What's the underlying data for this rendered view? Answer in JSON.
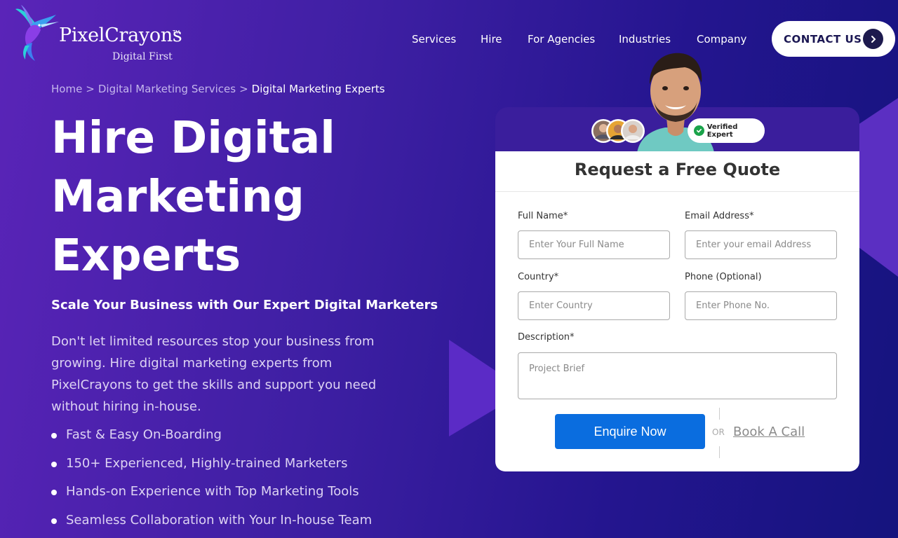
{
  "brand": {
    "name": "PixelCrayons",
    "tm": "TM",
    "tagline": "Digital First"
  },
  "nav": {
    "items": [
      "Services",
      "Hire",
      "For Agencies",
      "Industries",
      "Company"
    ],
    "contact_label": "CONTACT US"
  },
  "breadcrumb": {
    "home": "Home",
    "parent": "Digital Marketing Services",
    "current": "Digital Marketing Experts",
    "separator": ">"
  },
  "hero": {
    "title_lines": [
      "Hire Digital",
      "Marketing",
      "Experts"
    ],
    "subtitle": "Scale Your Business with Our Expert Digital Marketers",
    "description": "Don't let limited resources stop your business from growing. Hire digital marketing experts from PixelCrayons to get the skills and support you need without hiring in-house.",
    "bullets": [
      "Fast & Easy On-Boarding",
      "150+ Experienced, Highly-trained Marketers",
      "Hands-on Experience with Top Marketing Tools",
      "Seamless Collaboration with Your In-house Team"
    ]
  },
  "form": {
    "badge": "Verified Expert",
    "title": "Request a Free Quote",
    "full_name": {
      "label": "Full Name*",
      "placeholder": "Enter Your Full Name",
      "value": ""
    },
    "email": {
      "label": "Email Address*",
      "placeholder": "Enter your email Address",
      "value": ""
    },
    "country": {
      "label": "Country*",
      "placeholder": "Enter Country",
      "value": ""
    },
    "phone": {
      "label": "Phone (Optional)",
      "placeholder": "Enter Phone No.",
      "value": ""
    },
    "description": {
      "label": "Description*",
      "placeholder": "Project Brief",
      "value": ""
    },
    "submit_label": "Enquire Now",
    "or_text": "OR",
    "book_label": "Book A Call"
  },
  "colors": {
    "accent_blue": "#0a6ddf",
    "bg_purple": "#4a22ad",
    "bg_navy": "#16147e",
    "verified_green": "#1aa34a"
  }
}
